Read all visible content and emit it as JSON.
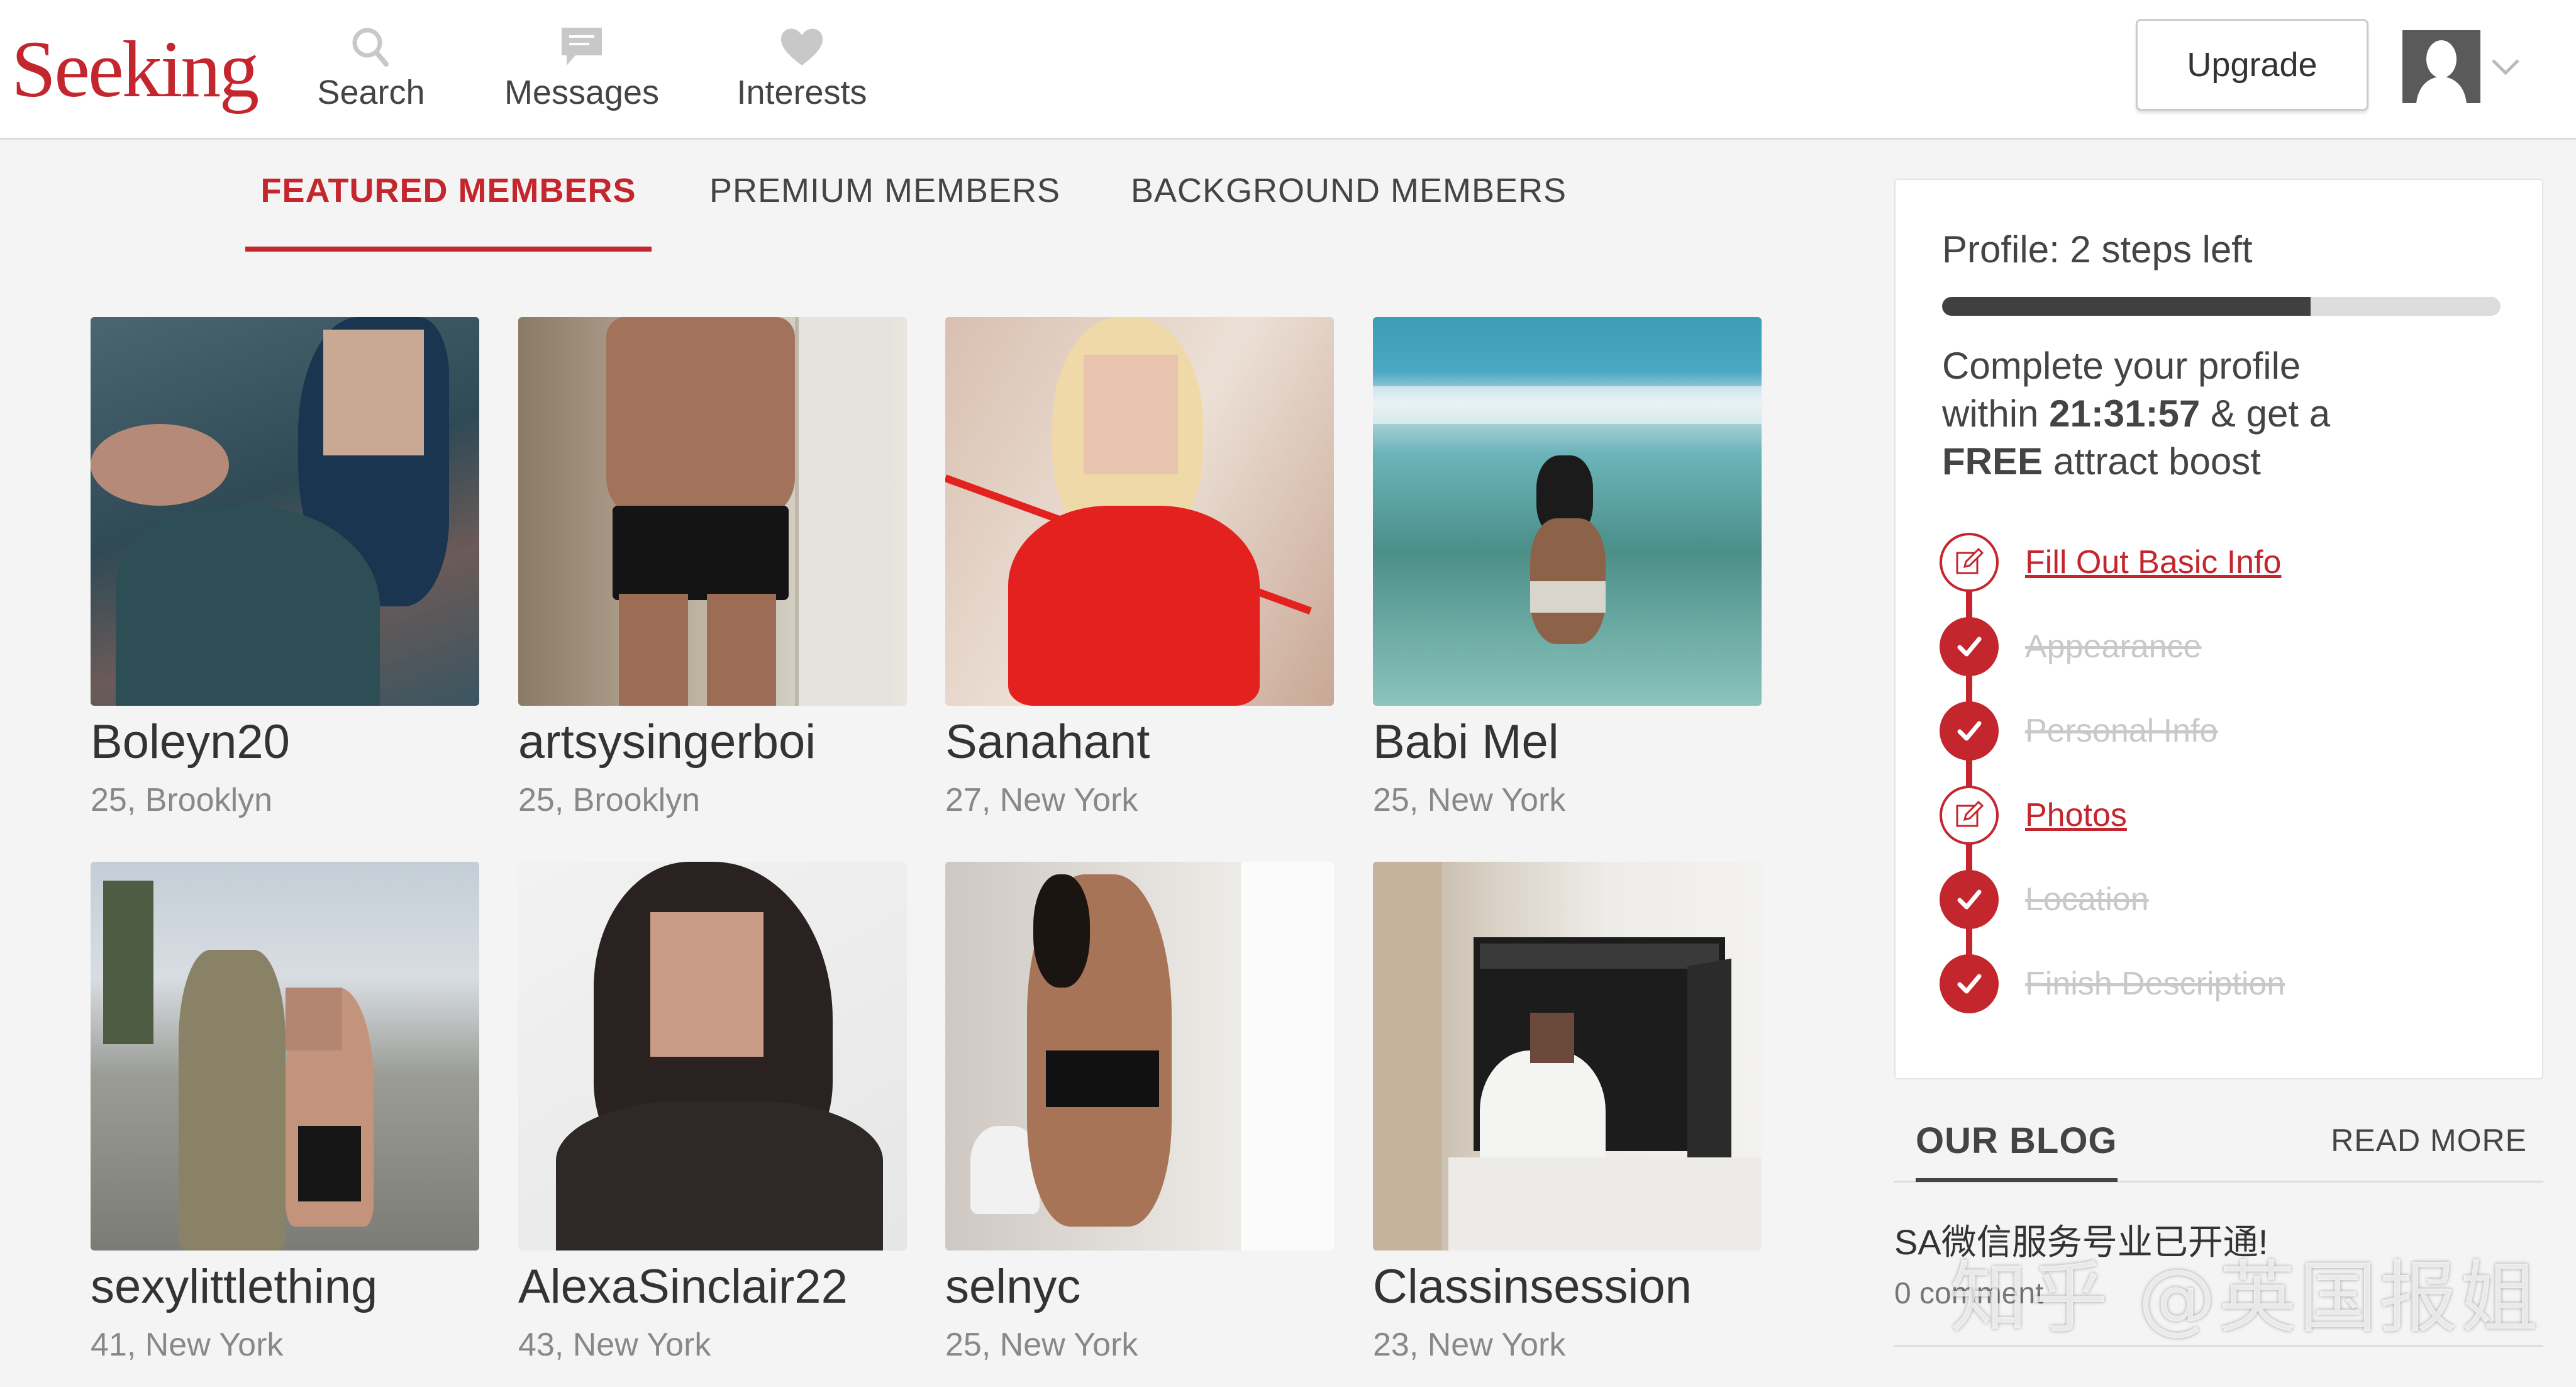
{
  "header": {
    "logo": "Seeking",
    "nav": [
      {
        "label": "Search",
        "icon": "search-icon"
      },
      {
        "label": "Messages",
        "icon": "speech-bubble-icon"
      },
      {
        "label": "Interests",
        "icon": "heart-icon"
      }
    ],
    "upgrade_label": "Upgrade"
  },
  "tabs": [
    {
      "label": "FEATURED MEMBERS",
      "active": true
    },
    {
      "label": "PREMIUM MEMBERS",
      "active": false
    },
    {
      "label": "BACKGROUND MEMBERS",
      "active": false
    }
  ],
  "members": [
    {
      "name": "Boleyn20",
      "meta": "25, Brooklyn"
    },
    {
      "name": "artsysingerboi",
      "meta": "25, Brooklyn"
    },
    {
      "name": "Sanahant",
      "meta": "27, New York"
    },
    {
      "name": "Babi Mel",
      "meta": "25, New York"
    },
    {
      "name": "sexylittlething",
      "meta": "41, New York"
    },
    {
      "name": "AlexaSinclair22",
      "meta": "43, New York"
    },
    {
      "name": "selnyc",
      "meta": "25, New York"
    },
    {
      "name": "Classinsession",
      "meta": "23, New York"
    }
  ],
  "profile": {
    "title": "Profile: 2 steps left",
    "progress_percent": 66,
    "message_line1": "Complete your profile",
    "message_within": "within ",
    "countdown": "21:31:57",
    "message_get": " & get a",
    "message_free": "FREE",
    "message_end": " attract boost",
    "steps": [
      {
        "label": "Fill Out Basic Info",
        "done": false
      },
      {
        "label": "Appearance",
        "done": true
      },
      {
        "label": "Personal Info",
        "done": true
      },
      {
        "label": "Photos",
        "done": false
      },
      {
        "label": "Location",
        "done": true
      },
      {
        "label": "Finish Description",
        "done": true
      }
    ]
  },
  "blog": {
    "title": "OUR BLOG",
    "read_more": "READ MORE",
    "post_title": "SA微信服务号业已开通!",
    "post_comments": "0 comment"
  },
  "watermark": "知乎 @英国报姐",
  "colors": {
    "brand": "#c4262e",
    "progress": "#404040"
  }
}
